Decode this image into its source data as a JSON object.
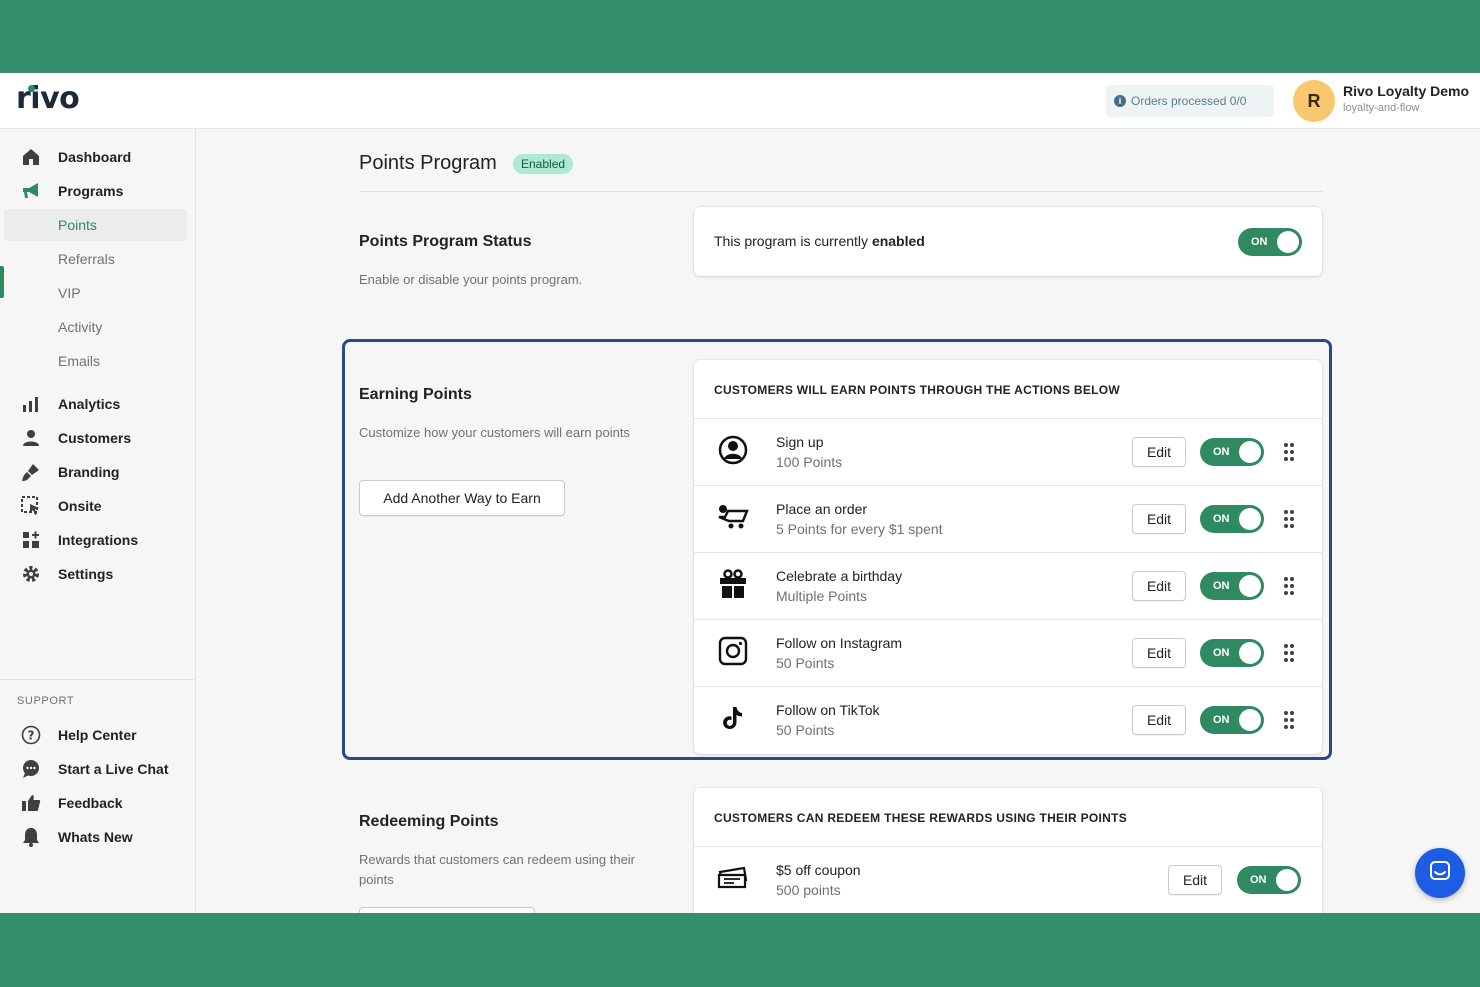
{
  "brand": {
    "logo_text": "rivo",
    "accent_color": "#2f8a62",
    "frame_color": "#348f6d"
  },
  "header": {
    "orders_processed": "Orders processed 0/0",
    "avatar_initial": "R",
    "store_name": "Rivo Loyalty Demo",
    "store_handle": "loyalty-and-flow"
  },
  "sidebar": {
    "items": [
      {
        "label": "Dashboard",
        "icon": "home-icon"
      },
      {
        "label": "Programs",
        "icon": "megaphone-icon"
      }
    ],
    "program_subitems": [
      "Points",
      "Referrals",
      "VIP",
      "Activity",
      "Emails"
    ],
    "lower_items": [
      {
        "label": "Analytics",
        "icon": "bar-chart-icon"
      },
      {
        "label": "Customers",
        "icon": "person-icon"
      },
      {
        "label": "Branding",
        "icon": "paint-brush-icon"
      },
      {
        "label": "Onsite",
        "icon": "onsite-icon"
      },
      {
        "label": "Integrations",
        "icon": "apps-icon"
      },
      {
        "label": "Settings",
        "icon": "gear-icon"
      }
    ],
    "support_heading": "SUPPORT",
    "support_items": [
      {
        "label": "Help Center",
        "icon": "help-icon"
      },
      {
        "label": "Start a Live Chat",
        "icon": "chat-icon"
      },
      {
        "label": "Feedback",
        "icon": "thumbs-up-icon"
      },
      {
        "label": "Whats New",
        "icon": "bell-icon"
      }
    ]
  },
  "page": {
    "title": "Points Program",
    "badge": "Enabled",
    "status_section": {
      "title": "Points Program Status",
      "description": "Enable or disable your points program.",
      "status_prefix": "This program is currently ",
      "status_value": "enabled",
      "toggle_label": "ON"
    },
    "earning_section": {
      "title": "Earning Points",
      "description": "Customize how your customers will earn points",
      "add_button": "Add Another Way to Earn",
      "card_header": "CUSTOMERS WILL EARN POINTS THROUGH THE ACTIONS BELOW",
      "rows": [
        {
          "title": "Sign up",
          "subtitle": "100 Points",
          "icon": "user-circle-icon",
          "edit": "Edit",
          "toggle": "ON"
        },
        {
          "title": "Place an order",
          "subtitle": "5 Points for every $1 spent",
          "icon": "cart-icon",
          "edit": "Edit",
          "toggle": "ON"
        },
        {
          "title": "Celebrate a birthday",
          "subtitle": "Multiple Points",
          "icon": "gift-icon",
          "edit": "Edit",
          "toggle": "ON"
        },
        {
          "title": "Follow on Instagram",
          "subtitle": "50 Points",
          "icon": "instagram-icon",
          "edit": "Edit",
          "toggle": "ON"
        },
        {
          "title": "Follow on TikTok",
          "subtitle": "50 Points",
          "icon": "tiktok-icon",
          "edit": "Edit",
          "toggle": "ON"
        }
      ]
    },
    "redeeming_section": {
      "title": "Redeeming Points",
      "description": "Rewards that customers can redeem using their points",
      "card_header": "CUSTOMERS CAN REDEEM THESE REWARDS USING THEIR POINTS",
      "rows": [
        {
          "title": "$5 off coupon",
          "subtitle": "500 points",
          "icon": "coupon-icon",
          "edit": "Edit",
          "toggle": "ON"
        }
      ]
    }
  }
}
